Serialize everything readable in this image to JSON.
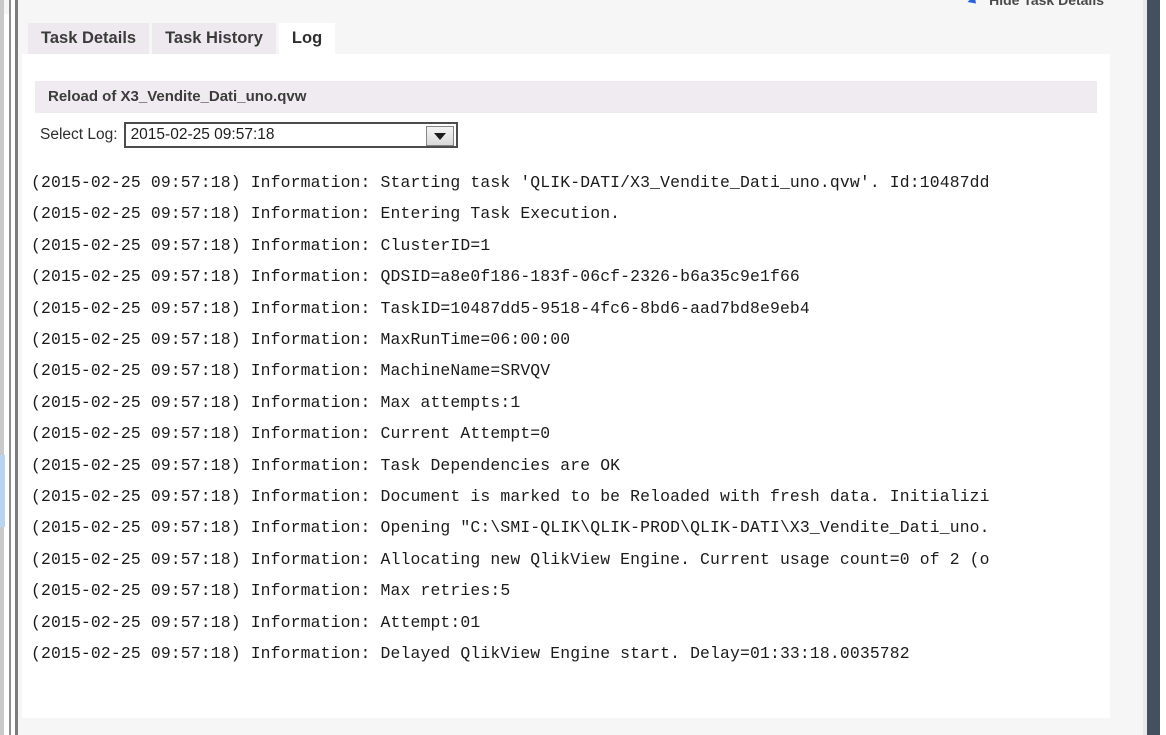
{
  "header": {
    "hide_task_details_label": "Hide Task Details",
    "hide_task_details_icon": "blue-arrow-icon"
  },
  "tabs": [
    {
      "label": "Task Details",
      "active": false
    },
    {
      "label": "Task History",
      "active": false
    },
    {
      "label": "Log",
      "active": true
    }
  ],
  "content": {
    "reload_heading": "Reload of X3_Vendite_Dati_uno.qvw",
    "select_log_label": "Select Log:",
    "select_log_value": "2015-02-25 09:57:18",
    "select_log_options": [
      "2015-02-25 09:57:18"
    ],
    "dropdown_icon": "chevron-down-icon"
  },
  "log": {
    "lines": [
      "(2015-02-25 09:57:18) Information: Starting task 'QLIK-DATI/X3_Vendite_Dati_uno.qvw'. Id:10487dd",
      "(2015-02-25 09:57:18) Information: Entering Task Execution.",
      "(2015-02-25 09:57:18) Information: ClusterID=1",
      "(2015-02-25 09:57:18) Information: QDSID=a8e0f186-183f-06cf-2326-b6a35c9e1f66",
      "(2015-02-25 09:57:18) Information: TaskID=10487dd5-9518-4fc6-8bd6-aad7bd8e9eb4",
      "(2015-02-25 09:57:18) Information: MaxRunTime=06:00:00",
      "(2015-02-25 09:57:18) Information: MachineName=SRVQV",
      "(2015-02-25 09:57:18) Information: Max attempts:1",
      "(2015-02-25 09:57:18) Information: Current Attempt=0",
      "(2015-02-25 09:57:18) Information: Task Dependencies are OK",
      "(2015-02-25 09:57:18) Information: Document is marked to be Reloaded with fresh data. Initializi",
      "(2015-02-25 09:57:18) Information: Opening \"C:\\SMI-QLIK\\QLIK-PROD\\QLIK-DATI\\X3_Vendite_Dati_uno.",
      "(2015-02-25 09:57:18) Information: Allocating new QlikView Engine. Current usage count=0 of 2 (o",
      "(2015-02-25 09:57:18) Information: Max retries:5",
      "(2015-02-25 09:57:18) Information: Attempt:01",
      "(2015-02-25 09:57:18) Information: Delayed QlikView Engine start. Delay=01:33:18.0035782"
    ]
  },
  "colors": {
    "tab_inactive_bg": "#eee9ee",
    "tab_active_bg": "#ffffff",
    "band_bg": "#f0ebf0",
    "page_bg": "#f6f6f6",
    "right_bar": "#44505e",
    "accent_blue": "#2a62d8",
    "scroll_thumb": "#b7d4f0"
  }
}
